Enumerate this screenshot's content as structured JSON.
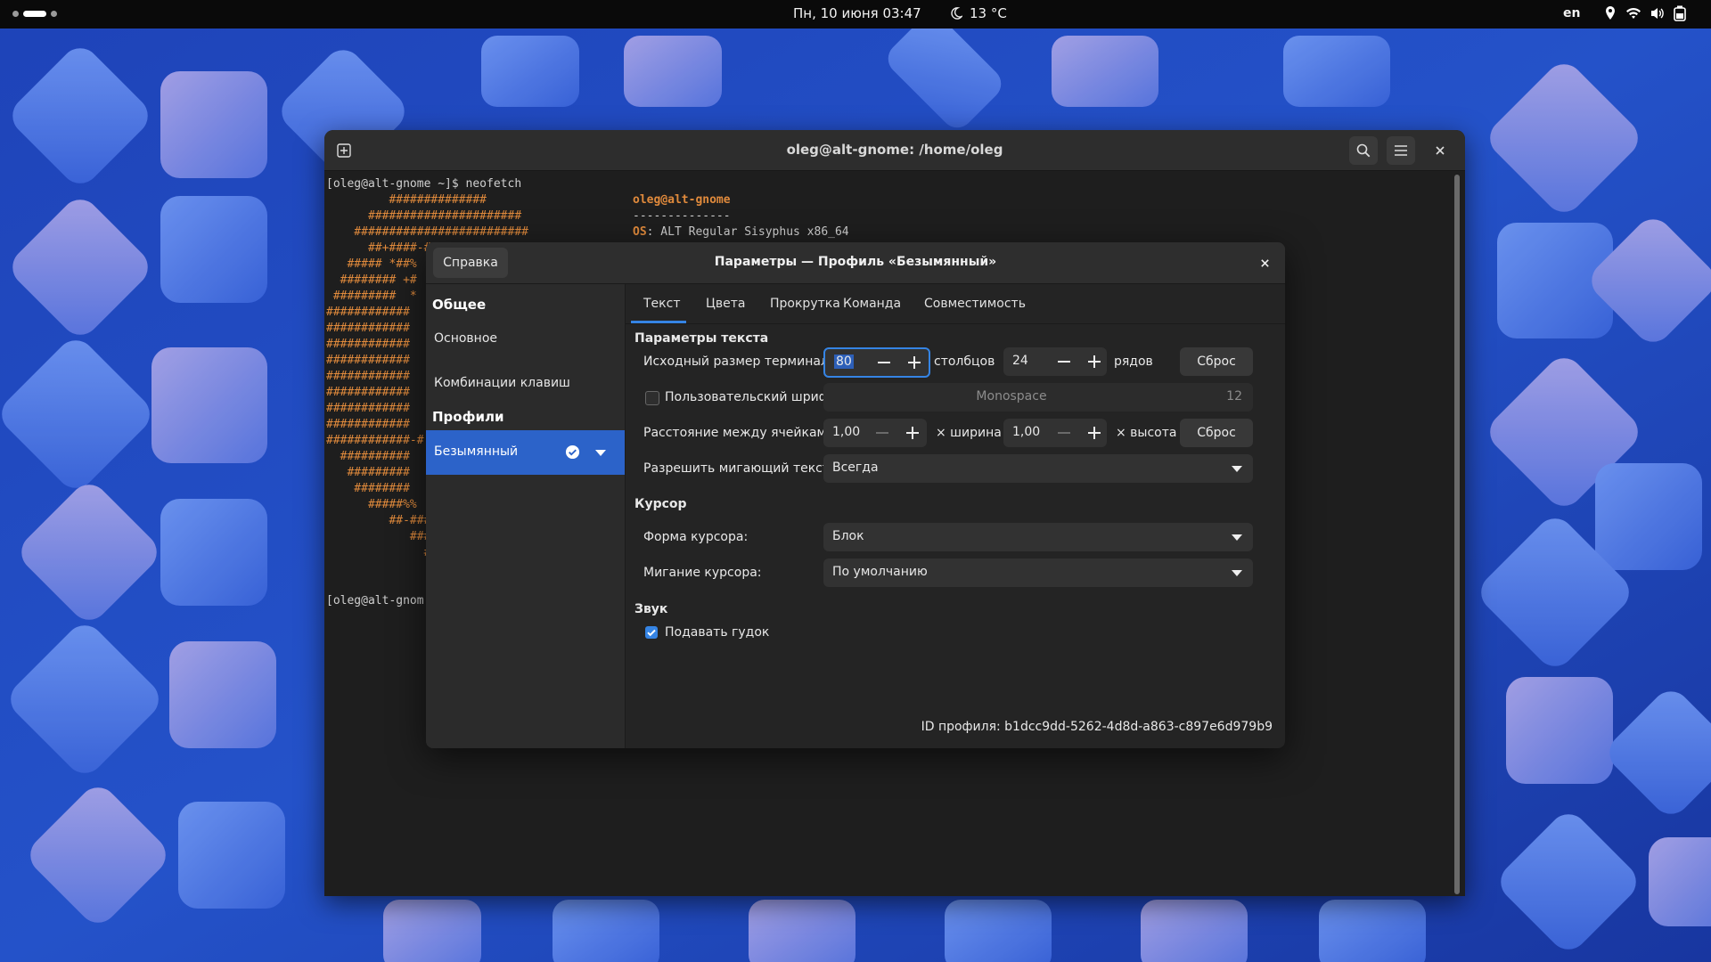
{
  "topbar": {
    "datetime": "Пн, 10 июня  03:47",
    "weather": "13 °C",
    "lang": "en",
    "icons": [
      "location-icon",
      "wifi-icon",
      "volume-icon",
      "battery-icon"
    ]
  },
  "terminal": {
    "title": "oleg@alt-gnome: /home/oleg",
    "lines": {
      "prompt": "[oleg@alt-gnome ~]$ neofetch",
      "host": "oleg@alt-gnome",
      "sep": "--------------",
      "os_label": "OS",
      "os_value": ": ALT Regular Sisyphus x86_64",
      "prompt2": "[oleg@alt-gnom"
    },
    "art": [
      "         ##############",
      "      ######################",
      "    #########################",
      "      ##+####-##",
      "   ##### *##%",
      "  ######## +#",
      " #########  *",
      "############",
      "############",
      "############",
      "############",
      "############",
      "############",
      "############",
      "############",
      "############-#",
      "  ##########",
      "   #########",
      "    ########",
      "      #####%%",
      "         ##-###",
      "            ###",
      "              #"
    ]
  },
  "prefs": {
    "title": "Параметры — Профиль «Безымянный»",
    "help_label": "Справка",
    "sidebar": {
      "general_header": "Общее",
      "item_basic": "Основное",
      "item_shortcuts": "Комбинации клавиш",
      "profiles_header": "Профили",
      "profile_name": "Безымянный"
    },
    "tabs": [
      "Текст",
      "Цвета",
      "Прокрутка",
      "Команда",
      "Совместимость"
    ],
    "text_section": {
      "title": "Параметры текста",
      "size_label": "Исходный размер терминала:",
      "columns": "80",
      "columns_unit": "столбцов",
      "rows": "24",
      "rows_unit": "рядов",
      "reset_label": "Сброс",
      "custom_font_label": "Пользовательский шрифт:",
      "font_name": "Monospace",
      "font_size": "12",
      "spacing_label": "Расстояние между ячейками:",
      "width_value": "1,00",
      "width_unit": "× ширина",
      "height_value": "1,00",
      "height_unit": "× высота",
      "blink_label": "Разрешить мигающий текст:",
      "blink_value": "Всегда"
    },
    "cursor_section": {
      "title": "Курсор",
      "shape_label": "Форма курсора:",
      "shape_value": "Блок",
      "blink_label": "Мигание курсора:",
      "blink_value": "По умолчанию"
    },
    "sound_section": {
      "title": "Звук",
      "bell_label": "Подавать гудок",
      "bell_checked": true
    },
    "profile_id_label": "ID профиля:",
    "profile_id": "b1dcc9dd-5262-4d8d-a863-c897e6d979b9"
  },
  "colors": {
    "accent": "#3584e4",
    "selected_row": "#2c63c9",
    "neofetch_orange": "#e08a3c"
  }
}
